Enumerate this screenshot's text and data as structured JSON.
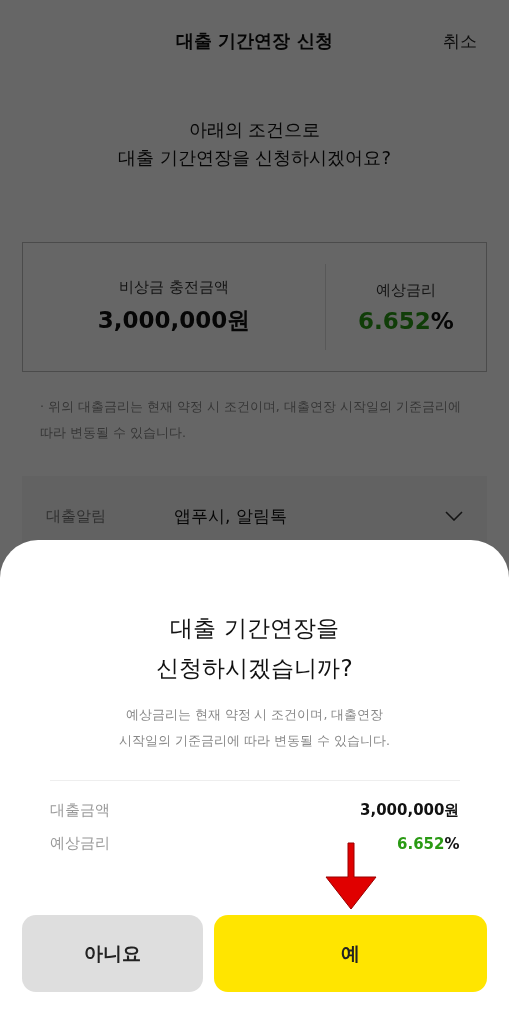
{
  "header": {
    "title": "대출 기간연장 신청",
    "cancel": "취소"
  },
  "question": [
    "아래의 조건으로",
    "대출 기간연장을 신청하시겠어요?"
  ],
  "summary": [
    {
      "label": "비상금 충전금액",
      "value": "3,000,000원",
      "kind": "amount"
    },
    {
      "label": "예상금리",
      "value": "6.652",
      "unit": "%",
      "kind": "rate"
    }
  ],
  "note": "· 위의 대출금리는 현재 약정 시 조건이며, 대출연장 시작일의 기준금리에 따라 변동될 수 있습니다.",
  "notice_row": {
    "label": "대출알림",
    "value": "앱푸시, 알림톡"
  },
  "dialog": {
    "title": [
      "대출 기간연장을",
      "신청하시겠습니까?"
    ],
    "description": [
      "예상금리는 현재 약정 시 조건이며, 대출연장",
      "시작일의 기준금리에 따라 변동될 수 있습니다."
    ],
    "rows": [
      {
        "label": "대출금액",
        "value": "3,000,000원",
        "kind": "amount"
      },
      {
        "label": "예상금리",
        "value": "6.652",
        "unit": "%",
        "kind": "rate"
      }
    ],
    "buttons": [
      {
        "label": "아니요",
        "kind": "secondary"
      },
      {
        "label": "예",
        "kind": "primary"
      }
    ]
  }
}
